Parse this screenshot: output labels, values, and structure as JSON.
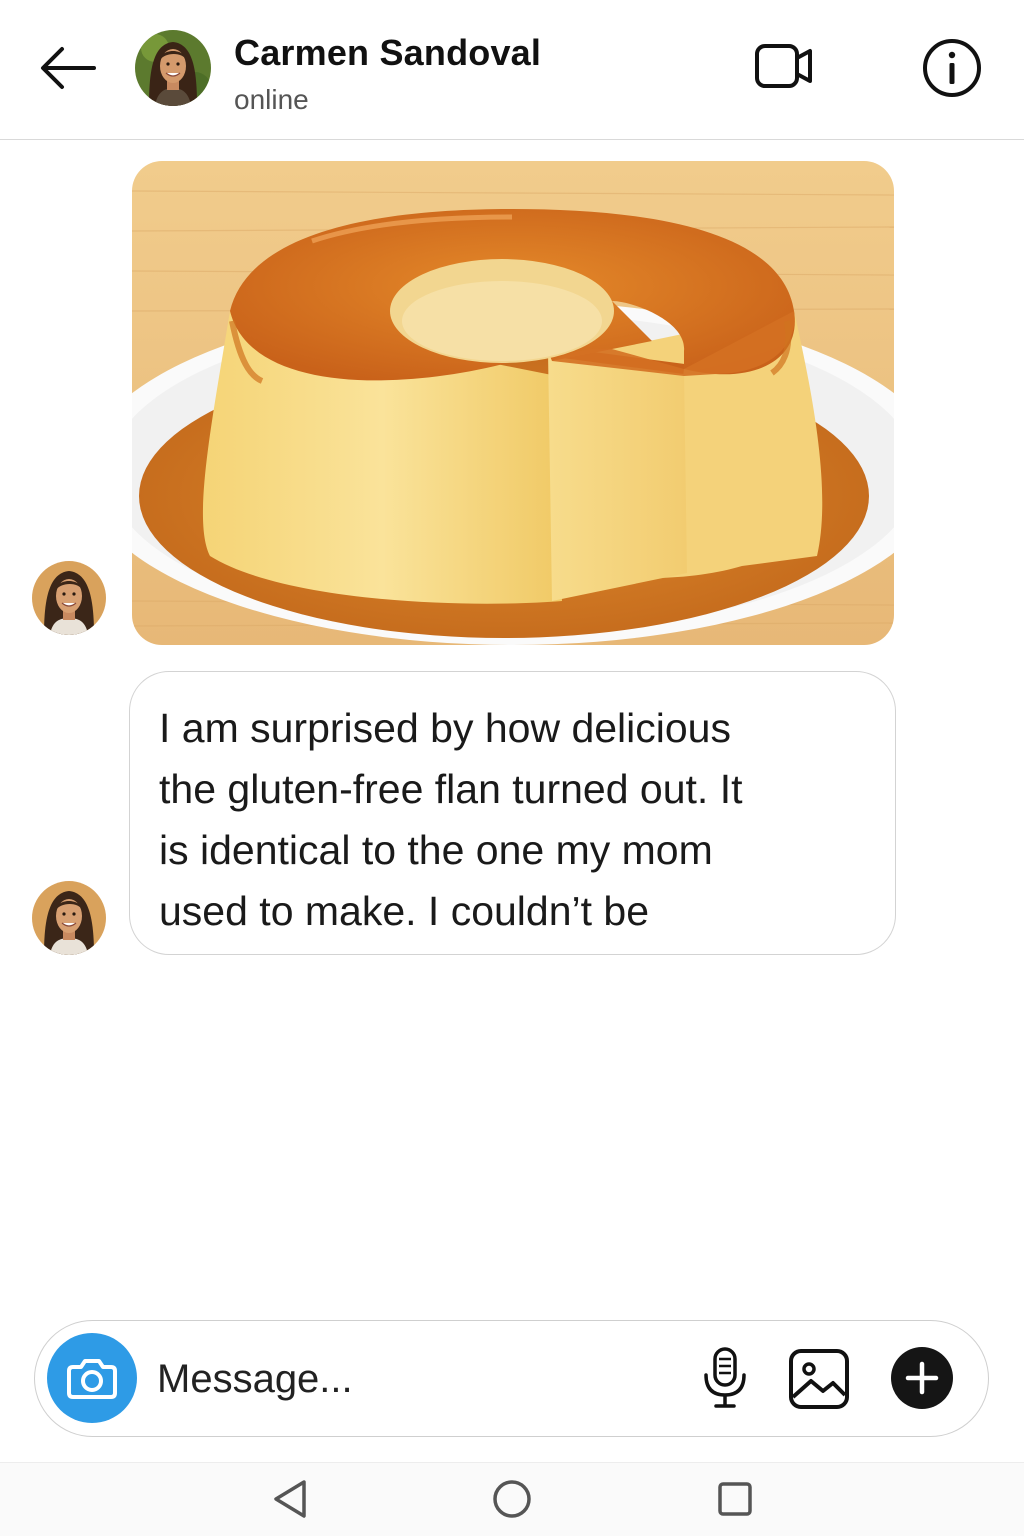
{
  "header": {
    "contact_name": "Carmen Sandoval",
    "status": "online",
    "icons": {
      "back": "arrow-left-icon",
      "video": "video-call-icon",
      "info": "info-icon"
    }
  },
  "messages": [
    {
      "type": "image",
      "sender": "contact",
      "content": "flan-photo"
    },
    {
      "type": "text",
      "sender": "contact",
      "text": "I am surprised by how delicious\nthe gluten-free flan turned out. It\nis identical to the one my mom\nused to make. I couldn’t be"
    }
  ],
  "composer": {
    "placeholder": "Message...",
    "icons": {
      "camera": "camera-icon",
      "mic": "microphone-icon",
      "gallery": "image-gallery-icon",
      "add": "plus-icon"
    }
  },
  "navbar": {
    "icons": [
      "back-triangle-icon",
      "home-circle-icon",
      "recents-square-icon"
    ]
  },
  "colors": {
    "accent_camera": "#2e9be6",
    "plus_button": "#151515",
    "caramel": "#d4761c",
    "custard": "#f3d177"
  }
}
